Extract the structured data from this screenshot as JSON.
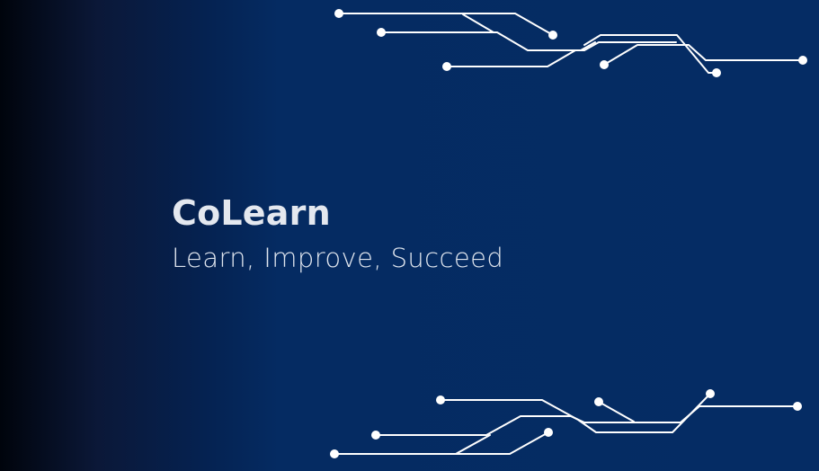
{
  "brand": {
    "title": "CoLearn",
    "tagline": "Learn, Improve, Succeed"
  },
  "colors": {
    "background_dark": "#00040c",
    "background_navy": "#052c64",
    "text": "#e4e8ef",
    "circuit": "#ffffff"
  },
  "decorations": {
    "top_circuit": "circuit-lines-graphic",
    "bottom_circuit": "circuit-lines-graphic"
  }
}
